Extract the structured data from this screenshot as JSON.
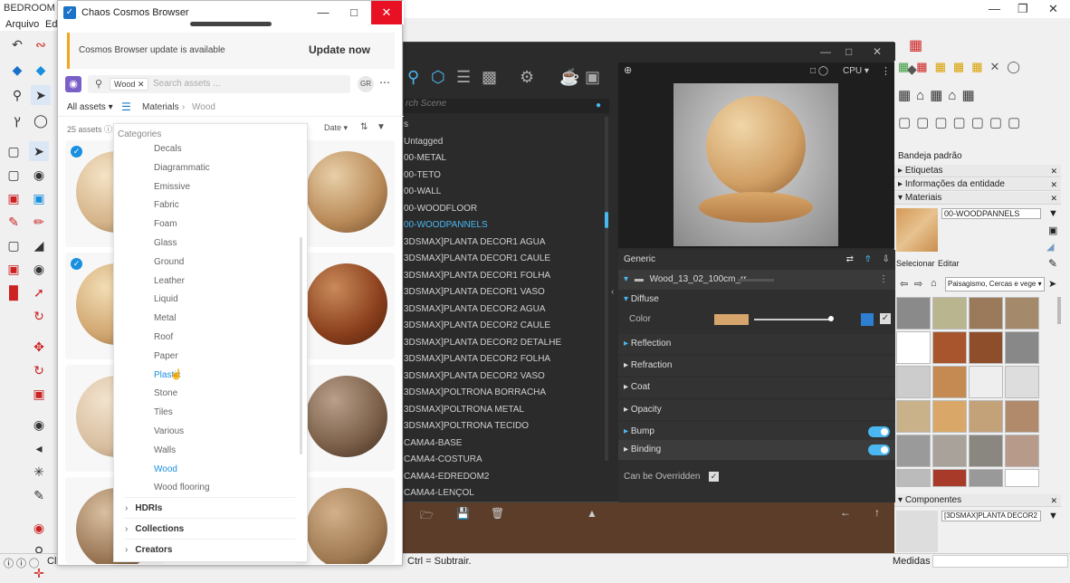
{
  "sketchup": {
    "title": "BEDROOM",
    "menu": [
      "Arquivo",
      "Ed"
    ],
    "status": {
      "hint": "Ctrl = Subtrair.",
      "measures_label": "Medidas",
      "left_fragment": "Cli"
    }
  },
  "vray": {
    "search_placeholder": "rch Scene",
    "list": [
      "s",
      "Untagged",
      "00-METAL",
      "00-TETO",
      "00-WALL",
      "00-WOODFLOOR",
      "00-WOODPANNELS",
      "3DSMAX]PLANTA DECOR1 AGUA",
      "3DSMAX]PLANTA DECOR1 CAULE",
      "3DSMAX]PLANTA DECOR1 FOLHA",
      "3DSMAX]PLANTA DECOR1 VASO",
      "3DSMAX]PLANTA DECOR2 AGUA",
      "3DSMAX]PLANTA DECOR2 CAULE",
      "3DSMAX]PLANTA DECOR2 DETALHE",
      "3DSMAX]PLANTA DECOR2 FOLHA",
      "3DSMAX]PLANTA DECOR2 VASO",
      "3DSMAX]POLTRONA BORRACHA",
      "3DSMAX]POLTRONA METAL",
      "3DSMAX]POLTRONA TECIDO",
      "CAMA4-BASE",
      "CAMA4-COSTURA",
      "CAMA4-EDREDOM2",
      "CAMA4-LENÇOL"
    ],
    "selected_index": 6,
    "render_mode": "CPU",
    "props": {
      "section": "Generic",
      "layer_name": "Wood_13_02_100cm_rr",
      "diffuse": "Diffuse",
      "color_label": "Color",
      "color_hex": "#d6a56c",
      "rows": [
        "Reflection",
        "Refraction",
        "Coat",
        "Opacity",
        "Bump",
        "Binding"
      ],
      "override_label": "Can be Overridden"
    }
  },
  "cosmos": {
    "window_title": "Chaos Cosmos Browser",
    "update_message": "Cosmos Browser update is available",
    "update_button": "Update now",
    "search_chip": "Wood",
    "search_placeholder": "Search assets ...",
    "avatar": "GR",
    "all_assets": "All assets",
    "breadcrumb": [
      "Materials",
      "Wood"
    ],
    "count": "25 assets",
    "sort": "Date",
    "categories_header": "Categories",
    "categories": [
      "Decals",
      "Diagrammatic",
      "Emissive",
      "Fabric",
      "Foam",
      "Glass",
      "Ground",
      "Leather",
      "Liquid",
      "Metal",
      "Roof",
      "Paper",
      "Plastic",
      "Stone",
      "Tiles",
      "Various",
      "Walls",
      "Wood",
      "Wood flooring"
    ],
    "hovered_category": "Plastic",
    "active_category": "Wood",
    "groups": [
      "HDRIs",
      "Collections",
      "Creators"
    ]
  },
  "tray": {
    "title": "Bandeja padrão",
    "panels": [
      "Etiquetas",
      "Informações da entidade",
      "Materiais"
    ],
    "material_name": "00-WOODPANNELS",
    "tabs": [
      "Selecionar",
      "Editar"
    ],
    "library": "Paisagismo, Cercas e vege",
    "components_title": "Componentes",
    "component_name": "[3DSMAX]PLANTA DECOR2"
  }
}
